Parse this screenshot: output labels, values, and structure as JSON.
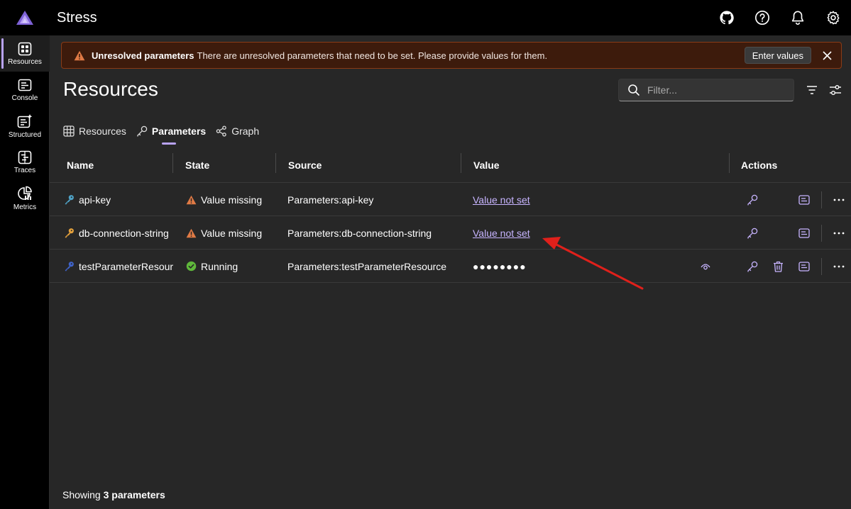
{
  "app": {
    "title": "Stress"
  },
  "top_icons": [
    "github-icon",
    "help-icon",
    "bell-icon",
    "gear-icon"
  ],
  "sidebar": {
    "items": [
      {
        "label": "Resources",
        "icon": "grid-icon",
        "active": true
      },
      {
        "label": "Console",
        "icon": "console-icon",
        "active": false
      },
      {
        "label": "Structured",
        "icon": "structured-icon",
        "active": false
      },
      {
        "label": "Traces",
        "icon": "traces-icon",
        "active": false
      },
      {
        "label": "Metrics",
        "icon": "metrics-icon",
        "active": false
      }
    ]
  },
  "banner": {
    "title": "Unresolved parameters",
    "message": "There are unresolved parameters that need to be set. Please provide values for them.",
    "button": "Enter values",
    "color": "#3d1b0c"
  },
  "page": {
    "title": "Resources"
  },
  "filter": {
    "placeholder": "Filter..."
  },
  "tabs": [
    {
      "label": "Resources",
      "active": false
    },
    {
      "label": "Parameters",
      "active": true
    },
    {
      "label": "Graph",
      "active": false
    }
  ],
  "table": {
    "headers": {
      "name": "Name",
      "state": "State",
      "source": "Source",
      "value": "Value",
      "actions": "Actions"
    },
    "rows": [
      {
        "name": "api-key",
        "state": "Value missing",
        "source": "Parameters:api-key",
        "value": "Value not set",
        "value_kind": "link"
      },
      {
        "name": "db-connection-string",
        "state": "Value missing",
        "source": "Parameters:db-connection-string",
        "value": "Value not set",
        "value_kind": "link"
      },
      {
        "name": "testParameterResource",
        "state": "Running",
        "source": "Parameters:testParameterResource",
        "value": "●●●●●●●●",
        "value_kind": "masked"
      }
    ]
  },
  "footer": {
    "prefix": "Showing",
    "count": "3",
    "suffix": "parameters"
  },
  "colors": {
    "accent": "#b9a3f5",
    "warning": "#e07a45",
    "success": "#5fb83b",
    "link": "#c7b4ff",
    "annotation": "#e0201b"
  }
}
